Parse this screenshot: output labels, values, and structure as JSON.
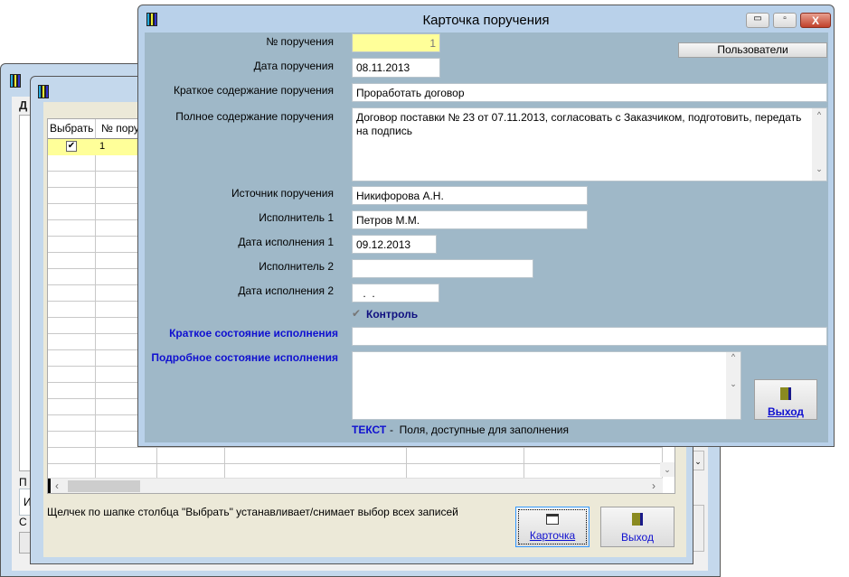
{
  "back_window": {
    "label_d": "Д",
    "label_p": "П",
    "field_i": "И",
    "label_s": "С"
  },
  "list_window": {
    "columns": [
      "Выбрать",
      "№ пору"
    ],
    "rows": [
      {
        "selected": true,
        "number": "1"
      }
    ],
    "hint": "Щелчек по шапке столбца \"Выбрать\" устанавливает/снимает выбор всех записей",
    "card_button": "Карточка",
    "exit_button": "Выход"
  },
  "card": {
    "title": "Карточка поручения",
    "users_button": "Пользователи",
    "fields": {
      "number": {
        "label": "№ поручения",
        "value": "1"
      },
      "date": {
        "label": "Дата поручения",
        "value": "08.11.2013"
      },
      "short": {
        "label": "Краткое содержание поручения",
        "value": "Проработать договор"
      },
      "full": {
        "label": "Полное содержание поручения",
        "value": "Договор поставки № 23 от 07.11.2013, согласовать с Заказчиком, подготовить, передать на подпись"
      },
      "source": {
        "label": "Источник поручения",
        "value": "Никифорова А.Н."
      },
      "exec1": {
        "label": "Исполнитель 1",
        "value": "Петров М.М."
      },
      "date1": {
        "label": "Дата исполнения 1",
        "value": "09.12.2013"
      },
      "exec2": {
        "label": "Исполнитель 2",
        "value": ""
      },
      "date2": {
        "label": "Дата исполнения 2",
        "value": " .  ."
      },
      "control": {
        "label": "Контроль",
        "checked": true
      },
      "state_short": {
        "label": "Краткое состояние исполнения",
        "value": ""
      },
      "state_full": {
        "label": "Подробное состояние исполнения",
        "value": ""
      }
    },
    "exit_button": "Выход",
    "legend_key": "ТЕКСТ",
    "legend_text": "-  Поля, доступные для заполнения"
  }
}
